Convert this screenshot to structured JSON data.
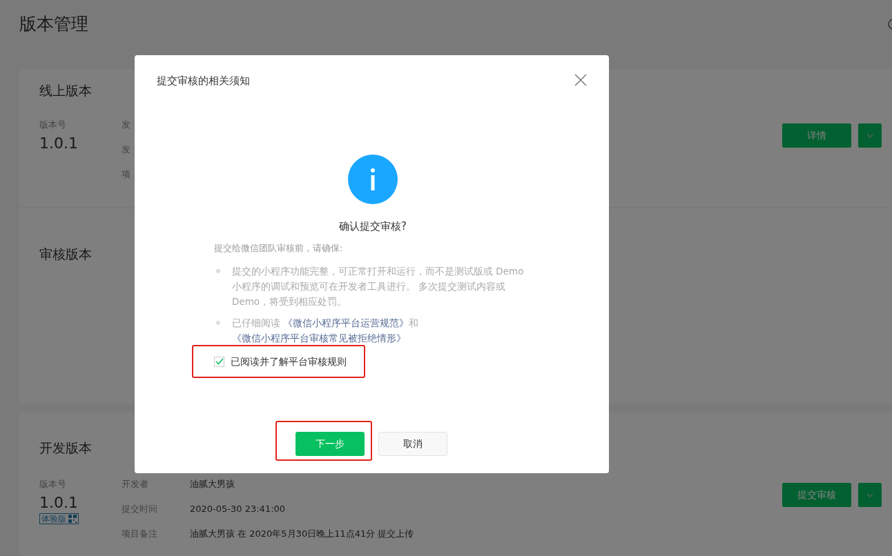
{
  "page_title": "版本管理",
  "sections": [
    {
      "title": "线上版本",
      "version_label": "版本号",
      "version": "1.0.1",
      "fields": [
        {
          "label": "发"
        },
        {
          "label": "发"
        },
        {
          "label": "项"
        }
      ],
      "button": "详情"
    },
    {
      "title": "审核版本"
    },
    {
      "title": "开发版本",
      "version_label": "版本号",
      "version": "1.0.1",
      "badge": "体验版",
      "fields": [
        {
          "label": "开发者",
          "value": "油腻大男孩"
        },
        {
          "label": "提交时间",
          "value": "2020-05-30 23:41:00"
        },
        {
          "label": "项目备注",
          "value": "油腻大男孩 在 2020年5月30日晚上11点41分 提交上传"
        }
      ],
      "button": "提交审核"
    }
  ],
  "dialog": {
    "title": "提交审核的相关须知",
    "heading": "确认提交审核?",
    "intro": "提交给微信团队审核前，请确保:",
    "bullets": [
      [
        {
          "text": "提交的小程序功能完整，可正常打开和运行，而不是测试版或 Demo 小程序的调试和预览可在开发者工具进行。 多次提交测试内容或Demo，将受到相应处罚。",
          "link": false
        }
      ],
      [
        {
          "text": "已仔细阅读 ",
          "link": false
        },
        {
          "text": "《微信小程序平台运营规范》",
          "link": true
        },
        {
          "text": "和 ",
          "link": false
        },
        {
          "text": "《微信小程序平台审核常见被拒绝情形》",
          "link": true
        }
      ]
    ],
    "agreement": {
      "label": "已阅读并了解平台审核规则",
      "checked": true
    },
    "buttons": [
      {
        "label": "下一步",
        "kind": "primary"
      },
      {
        "label": "取消",
        "kind": "default"
      }
    ]
  }
}
